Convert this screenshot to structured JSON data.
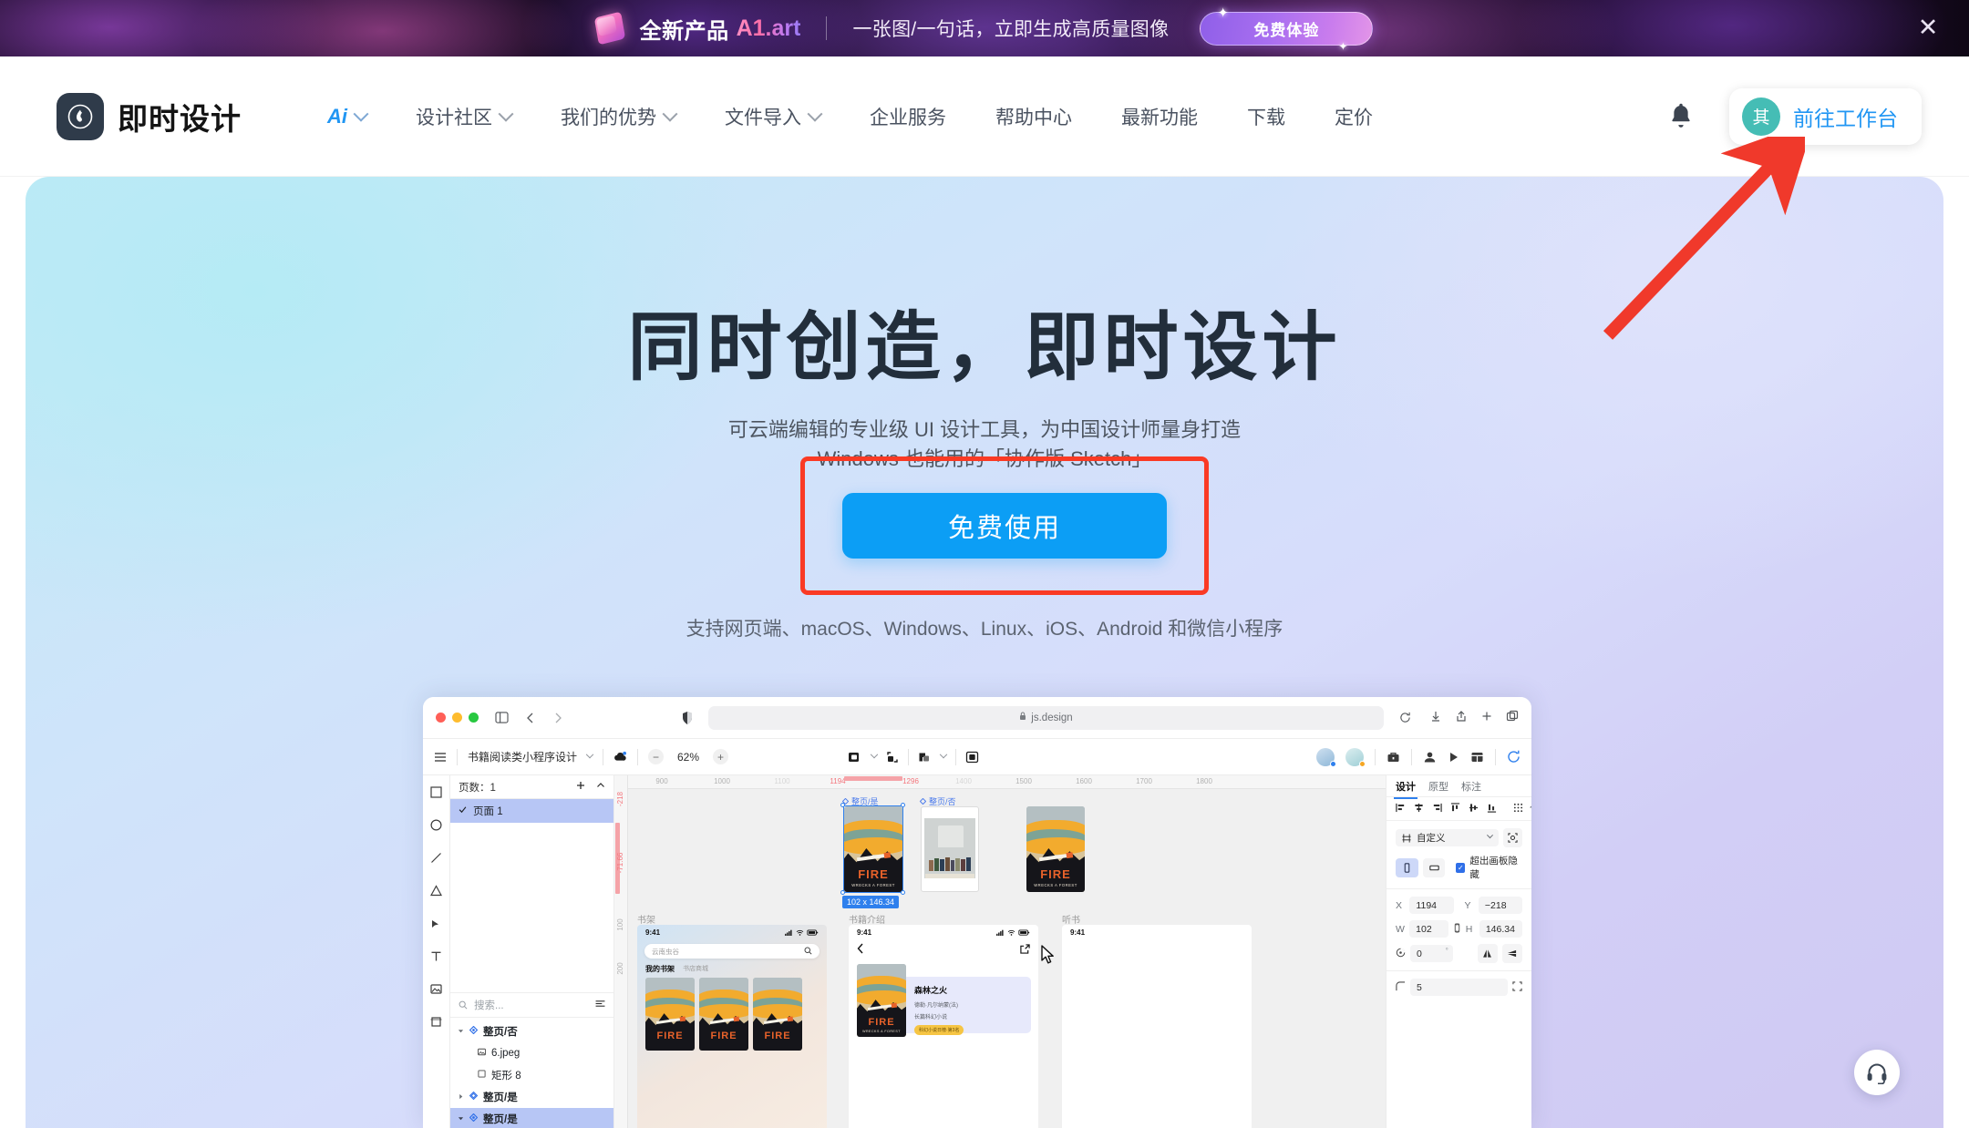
{
  "promo_banner": {
    "icon": "cube-icon",
    "title": "全新产品",
    "brand": "A1.art",
    "subtitle": "一张图/一句话，立即生成高质量图像",
    "cta_label": "免费体验",
    "close_icon": "close-icon"
  },
  "navbar": {
    "logo_icon": "jishi-logo-icon",
    "brand": "即时设计",
    "items": [
      {
        "label": "Ai",
        "has_chevron": true,
        "accent": true
      },
      {
        "label": "设计社区",
        "has_chevron": true
      },
      {
        "label": "我们的优势",
        "has_chevron": true
      },
      {
        "label": "文件导入",
        "has_chevron": true
      },
      {
        "label": "企业服务",
        "has_chevron": false
      },
      {
        "label": "帮助中心",
        "has_chevron": false
      },
      {
        "label": "最新功能",
        "has_chevron": false
      },
      {
        "label": "下载",
        "has_chevron": false
      },
      {
        "label": "定价",
        "has_chevron": false
      }
    ],
    "bell_icon": "bell-icon",
    "avatar_text": "其",
    "workbench_label": "前往工作台"
  },
  "hero": {
    "title": "同时创造，即时设计",
    "sub_line1": "可云端编辑的专业级 UI 设计工具，为中国设计师量身打造",
    "sub_line2": "Windows 也能用的「协作版 Sketch」",
    "cta_label": "免费使用",
    "note": "支持网页端、macOS、Windows、Linux、iOS、Android 和微信小程序",
    "highlight_color": "#fa3a24",
    "cta_color": "#0c9ef5"
  },
  "annotation": {
    "arrow_color": "#f0392b",
    "arrow_name": "red-pointer-arrow"
  },
  "app_mockup": {
    "browser": {
      "url": "js.design",
      "lock_icon": "lock-icon",
      "back_icon": "chevron-left-icon",
      "forward_icon": "chevron-right-icon",
      "sidebar_icon": "sidebar-toggle-icon",
      "shield_icon": "shield-icon",
      "download_icon": "download-icon",
      "share_icon": "share-icon",
      "newtab_icon": "plus-icon",
      "tabs_icon": "tabs-icon",
      "reload_icon": "reload-icon"
    },
    "toolbar": {
      "menu_icon": "hamburger-icon",
      "doc_name": "书籍阅读类小程序设计",
      "zoom_out": "−",
      "zoom_level": "62%",
      "zoom_in": "+",
      "cloud_icon": "cloud-status-icon",
      "frame_icon": "frame-tool-icon",
      "export_icon": "export-icon",
      "component_icon": "component-icon",
      "mask_icon": "mask-icon",
      "briefcase_icon": "briefcase-icon",
      "invite_icon": "invite-user-icon",
      "play_icon": "play-icon",
      "layout_icon": "layout-icon",
      "history_icon": "history-icon"
    },
    "tools": [
      "rect-tool-icon",
      "ellipse-tool-icon",
      "line-tool-icon",
      "triangle-tool-icon",
      "pen-tool-icon",
      "text-tool-icon",
      "image-tool-icon",
      "frame-tool-icon"
    ],
    "layers_panel": {
      "pages_label": "页数：1",
      "add_icon": "plus-icon",
      "collapse_icon": "chevron-up-icon",
      "page_item": "页面 1",
      "search_placeholder": "搜索...",
      "filter_icon": "filter-icon",
      "layers": [
        {
          "name": "整页/否",
          "type": "component",
          "depth": 0,
          "expanded": true,
          "selected": false
        },
        {
          "name": "6.jpeg",
          "type": "image",
          "depth": 1,
          "selected": false
        },
        {
          "name": "矩形 8",
          "type": "rect",
          "depth": 1,
          "selected": false
        },
        {
          "name": "整页/是",
          "type": "component-set",
          "depth": 0,
          "expanded": false,
          "selected": false
        },
        {
          "name": "整页/是",
          "type": "component",
          "depth": 0,
          "expanded": true,
          "selected": true
        }
      ]
    },
    "canvas": {
      "ruler_h_ticks": [
        "900",
        "1000",
        "1100",
        "1194",
        "1296",
        "1400",
        "1500",
        "1600",
        "1700",
        "1800"
      ],
      "ruler_h_hot": [
        "1194",
        "1296"
      ],
      "ruler_v_ticks": [
        "-218",
        "-71.66",
        "100",
        "200"
      ],
      "ruler_v_hot": [
        "-218",
        "-71.66"
      ],
      "artboards": [
        {
          "label": "整页/是",
          "selected": true
        },
        {
          "label": "整页/否",
          "selected": false
        }
      ],
      "size_badge": "102 x 146.34",
      "frame_titles": [
        "书架",
        "书籍介绍",
        "听书"
      ],
      "poster": {
        "title": "FIRE",
        "caption": "WRECKS A FOREST"
      },
      "phone_bookshelf": {
        "time": "9:41",
        "search_value": "云南虫谷",
        "tab_active": "我的书架",
        "tab_inactive": "书店商城"
      },
      "phone_bookdetail": {
        "time": "9:41",
        "book_title": "森林之火",
        "book_author": "德勒·凡尔纳蒙(法)",
        "book_genre": "长篇科幻小说",
        "book_badge": "科幻小说日榜·第3名"
      },
      "phone_listen": {
        "time": "9:41"
      }
    },
    "props_panel": {
      "tabs": [
        "设计",
        "原型",
        "标注"
      ],
      "active_tab": "设计",
      "align_icons": [
        "align-left-icon",
        "align-center-h-icon",
        "align-right-icon",
        "align-top-icon",
        "align-center-v-icon",
        "align-bottom-icon",
        "distribute-icon"
      ],
      "constraint_label": "自定义",
      "constraint_icon": "constraint-icon",
      "scale_icon": "scale-icon",
      "orientation_portrait_icon": "portrait-icon",
      "orientation_landscape_icon": "landscape-icon",
      "clip_checkbox_label": "超出画板隐藏",
      "clip_checked": true,
      "fields": {
        "x_label": "X",
        "x_value": "1194",
        "y_label": "Y",
        "y_value": "−218",
        "w_label": "W",
        "w_value": "102",
        "h_label": "H",
        "h_value": "146.34",
        "rotation_value": "0",
        "rotation_unit": "°",
        "corner_value": "5"
      },
      "flip_h_icon": "flip-horizontal-icon",
      "flip_v_icon": "flip-vertical-icon",
      "link_icon": "link-ratio-icon",
      "corner_icon": "corner-radius-icon",
      "corner_expand_icon": "corner-expand-icon"
    }
  },
  "floating": {
    "headset_icon": "headset-icon"
  }
}
